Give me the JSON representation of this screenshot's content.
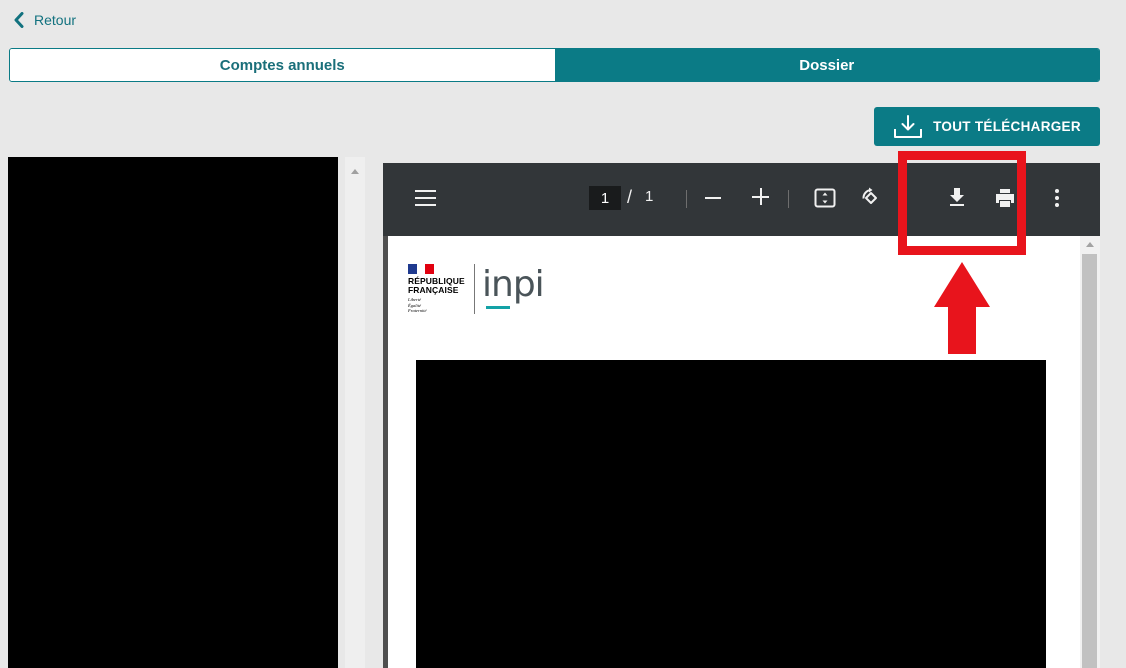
{
  "nav": {
    "back_label": "Retour"
  },
  "tabs": [
    {
      "label": "Comptes annuels",
      "active": false
    },
    {
      "label": "Dossier",
      "active": true
    }
  ],
  "actions": {
    "download_all_label": "TOUT TÉLÉCHARGER"
  },
  "pdf_viewer": {
    "current_page": "1",
    "page_separator": "/",
    "total_pages": "1",
    "toolbar_icons": [
      "menu-icon",
      "zoom-out-icon",
      "zoom-in-icon",
      "fit-page-icon",
      "rotate-icon",
      "download-icon",
      "print-icon",
      "more-options-icon"
    ],
    "document": {
      "issuer_line1": "RÉPUBLIQUE",
      "issuer_line2": "FRANÇAISE",
      "motto": [
        "Liberté",
        "Égalité",
        "Fraternité"
      ],
      "brand": "inpi"
    }
  },
  "annotation": {
    "color": "#e8141c",
    "target": "download-icon"
  },
  "colors": {
    "accent": "#0b7b86",
    "toolbar": "#323639",
    "background": "#e8e8e8"
  }
}
